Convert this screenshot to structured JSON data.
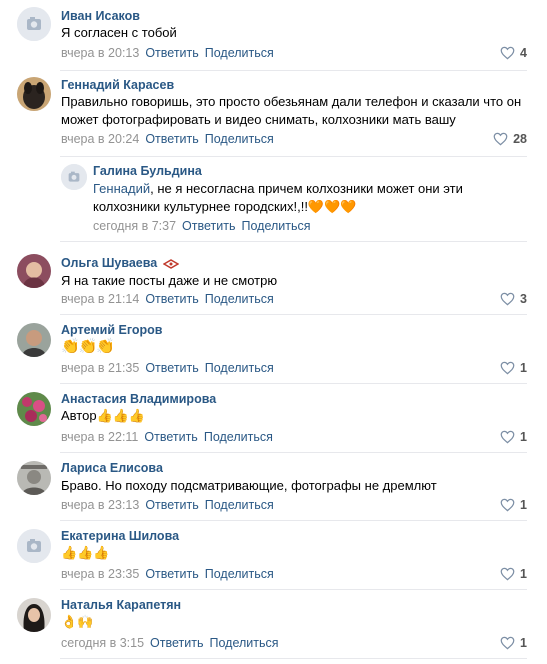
{
  "actions": {
    "reply": "Ответить",
    "share": "Поделиться"
  },
  "comments": [
    {
      "author": "Иван Исаков",
      "text": "Я согласен с тобой",
      "time": "вчера в 20:13",
      "likes": "4"
    },
    {
      "author": "Геннадий Карасев",
      "text": "Правильно говоришь, это просто обезьянам дали телефон и сказали что он может фотографировать и видео снимать, колхозники мать вашу",
      "time": "вчера в 20:24",
      "likes": "28"
    },
    {
      "author": "Галина Бульдина",
      "mention": "Геннадий",
      "text": ", не я несогласна причем колхозники может они эти колхозники культурнее городских!,!!🧡🧡🧡",
      "time": "сегодня в 7:37"
    },
    {
      "author": "Ольга Шуваева",
      "text": "Я на такие посты даже и не смотрю",
      "time": "вчера в 21:14",
      "likes": "3"
    },
    {
      "author": "Артемий Егоров",
      "text": "👏👏👏",
      "time": "вчера в 21:35",
      "likes": "1"
    },
    {
      "author": "Анастасия Владимирова",
      "text": "Автор👍👍👍",
      "time": "вчера в 22:11",
      "likes": "1"
    },
    {
      "author": "Лариса Елисова",
      "text": "Браво. Но походу подсматривающие, фотографы не дремлют",
      "time": "вчера в 23:13",
      "likes": "1"
    },
    {
      "author": "Екатерина Шилова",
      "text": "👍👍👍",
      "time": "вчера в 23:35",
      "likes": "1"
    },
    {
      "author": "Наталья Карапетян",
      "text": "👌🙌",
      "time": "сегодня в 3:15",
      "likes": "1"
    }
  ]
}
